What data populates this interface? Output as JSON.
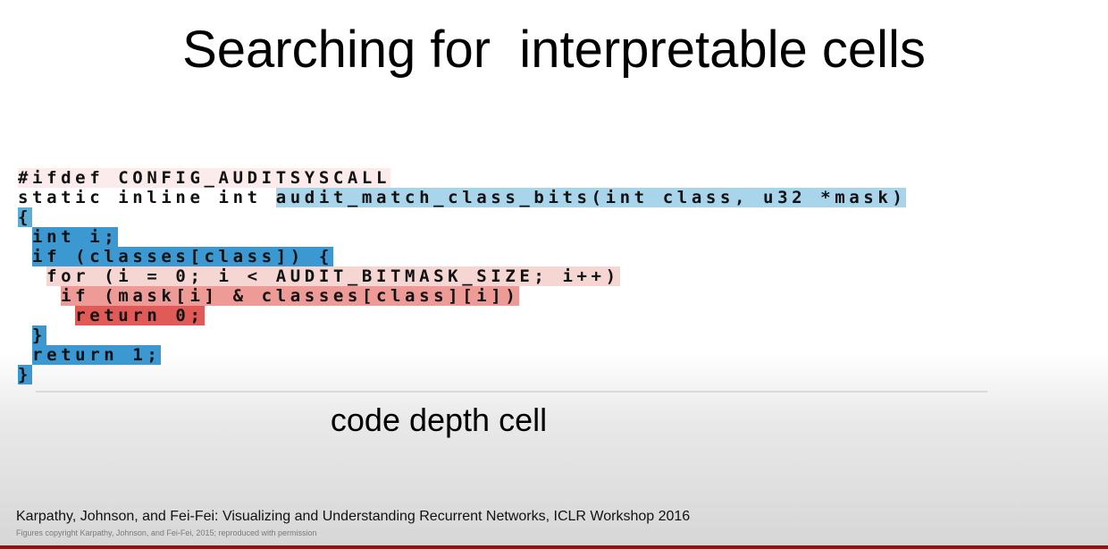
{
  "slide": {
    "title": "Searching for  interpretable cells",
    "caption": "code depth cell",
    "citation": "Karpathy, Johnson, and Fei-Fei: Visualizing and Understanding Recurrent Networks, ICLR Workshop 2016",
    "copyright": "Figures copyright Karpathy, Johnson, and Fei-Fei, 2015; reproduced with permission"
  },
  "code": {
    "line1": {
      "text": "#ifdef CONFIG_AUDITSYSCALL"
    },
    "line2": {
      "plain": "static inline int ",
      "highlighted": "audit_match_class_bits(int class, u32 *mask)"
    },
    "line3": {
      "text": "{"
    },
    "line4": {
      "indent": " ",
      "text": "int i;"
    },
    "line5": {
      "indent": " ",
      "text": "if (classes[class]) {"
    },
    "line6": {
      "indent": "  ",
      "text": "for (i = 0; i < AUDIT_BITMASK_SIZE; i++)"
    },
    "line7": {
      "indent": "   ",
      "text": "if (mask[i] & classes[class][i])"
    },
    "line8": {
      "indent": "    ",
      "text": "return 0;"
    },
    "line9": {
      "indent": " ",
      "text": "}"
    },
    "line10": {
      "indent": " ",
      "text": "return 1;"
    },
    "line11": {
      "text": "}"
    }
  },
  "colors": {
    "light_blue": "#a9d5ea",
    "medium_blue": "#5aaed7",
    "dark_blue": "#3b98d0",
    "light_pink": "#f6d6d3",
    "medium_red": "#ee9a96",
    "dark_red": "#e05a57",
    "accent_bar": "#8c1515"
  }
}
